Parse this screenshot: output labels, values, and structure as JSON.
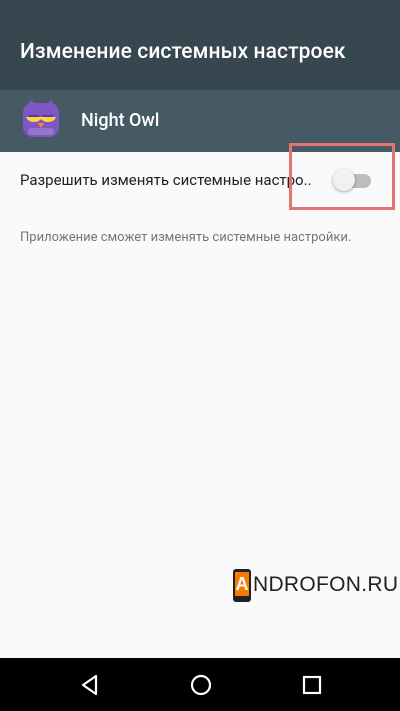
{
  "app_bar": {
    "title": "Изменение системных настроек"
  },
  "app_header": {
    "icon": "night-owl-app-icon",
    "name": "Night Owl"
  },
  "setting": {
    "label": "Разрешить изменять системные настро..",
    "toggle_state": "off",
    "summary": "Приложение сможет изменять системные настройки."
  },
  "watermark": {
    "letter": "A",
    "text": "NDROFON.RU"
  },
  "nav_bar": {
    "back_icon": "back-triangle-icon",
    "home_icon": "home-circle-icon",
    "recents_icon": "recents-square-icon"
  },
  "colors": {
    "app_bar": "#37474f",
    "app_header": "#455a64",
    "highlight": "#e57373",
    "background": "#fafafa"
  }
}
